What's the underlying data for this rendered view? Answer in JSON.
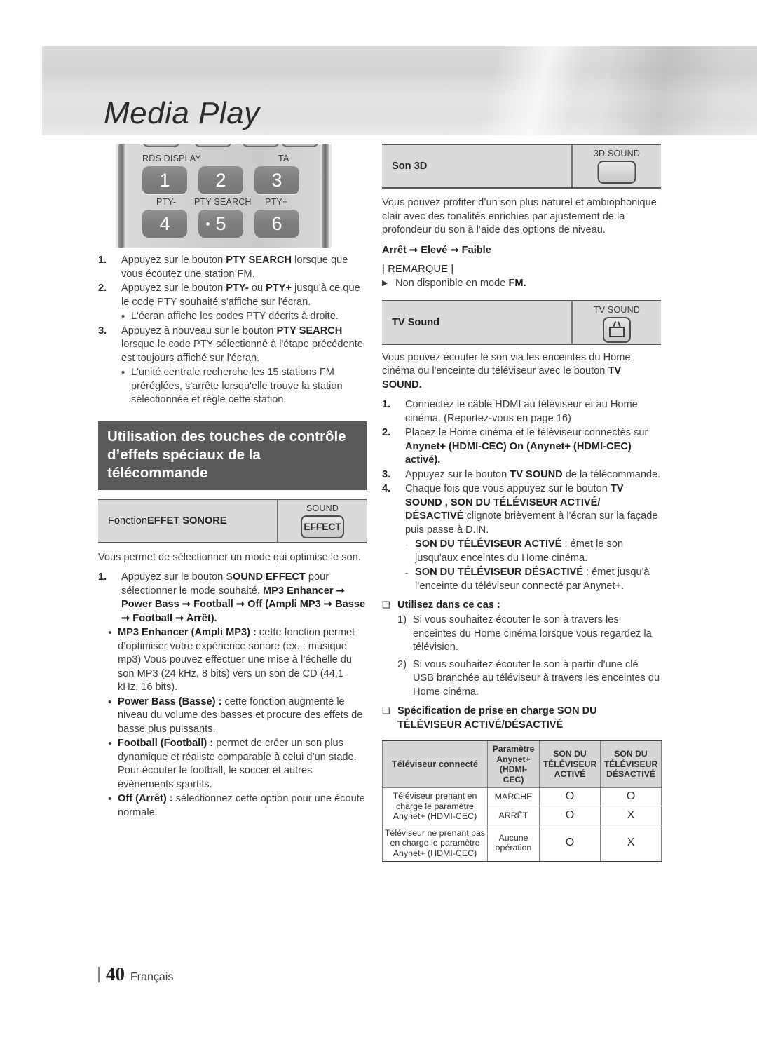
{
  "header": {
    "title": "Media Play"
  },
  "remote": {
    "labels": {
      "rds": "RDS DISPLAY",
      "ta": "TA",
      "ptyminus": "PTY-",
      "ptysearch": "PTY SEARCH",
      "ptyplus": "PTY+"
    },
    "keys": [
      "1",
      "2",
      "3",
      "4",
      "5",
      "6"
    ]
  },
  "left": {
    "steps": [
      {
        "num": "1.",
        "html": "Appuyez sur le bouton <b>PTY SEARCH</b> lorsque que vous écoutez une station FM."
      },
      {
        "num": "2.",
        "html": "Appuyez sur le bouton <b>PTY-</b> ou <b>PTY+</b> jusqu'à ce que le code PTY souhaité s'affiche sur l'écran."
      },
      {
        "num": "3.",
        "html": "Appuyez à nouveau sur le bouton <b>PTY SEARCH</b> lorsque le code PTY sélectionné à l'étape précédente est toujours affiché sur l'écran."
      }
    ],
    "bullet_after_2": "L'écran affiche les codes PTY décrits à droite.",
    "bullet_after_3": "L'unité centrale recherche les 15 stations FM préréglées, s'arrête lorsqu'elle trouve la station sélectionnée et règle cette station.",
    "section_title": "Utilisation des touches de contrôle d’effets spéciaux de la télécommande",
    "feature": {
      "label_plain": "Fonction ",
      "label_bold": "EFFET SONORE",
      "key_label": "SOUND",
      "key_text": "EFFECT"
    },
    "intro": "Vous permet de sélectionner un mode qui optimise le son.",
    "step1": {
      "num": "1.",
      "html": "Appuyez sur le bouton S<b>OUND EFFECT</b> pour sélectionner le mode souhaité. <b>MP3 Enhancer ➞ Power Bass ➞ Football ➞ Off (Ampli MP3 ➞ Basse ➞ Football ➞ Arrêt).</b>"
    },
    "mode_bullets": [
      "<b>MP3 Enhancer (Ampli MP3) :</b> cette fonction permet d’optimiser votre expérience sonore (ex. : musique mp3) Vous pouvez effectuer une mise à l’échelle du son MP3 (24 kHz, 8 bits) vers un son de CD (44,1 kHz, 16 bits).",
      "<b>Power Bass (Basse) :</b> cette fonction augmente le niveau du volume des basses et procure des effets de basse plus puissants.",
      "<b>Football (Football) :</b> permet de créer un son plus dynamique et réaliste comparable à celui d’un stade. Pour écouter le football, le soccer et autres événements sportifs.",
      "<b>Off (Arrêt) :</b> sélectionnez cette option pour une écoute normale."
    ]
  },
  "right": {
    "feature_3d": {
      "label": "Son 3D",
      "key_label": "3D SOUND"
    },
    "para_3d": "Vous pouvez profiter d’un son plus naturel et ambiophonique clair avec des tonalités enrichies par ajustement de la profondeur du son à l’aide des options de niveau.",
    "cycle_3d": "Arrêt ➞ Elevé ➞ Faible",
    "note_title": "| REMARQUE |",
    "note_item": "Non disponible en mode <b>FM.</b>",
    "feature_tv": {
      "label": "TV Sound",
      "key_label": "TV SOUND"
    },
    "para_tv": "Vous pouvez écouter le son via les enceintes du Home cinéma ou l'enceinte du téléviseur avec le bouton <b>TV SOUND.</b>",
    "steps": [
      {
        "num": "1.",
        "html": "Connectez le câble HDMI au téléviseur et au Home cinéma. (Reportez-vous en page 16)"
      },
      {
        "num": "2.",
        "html": "Placez le Home cinéma et le téléviseur connectés sur <b>Anynet+ (HDMI-CEC) On (Anynet+ (HDMI-CEC) activé).</b>"
      },
      {
        "num": "3.",
        "html": "Appuyez sur le bouton <b>TV SOUND</b> de la télécommande."
      },
      {
        "num": "4.",
        "html": "Chaque fois que vous appuyez sur le bouton <b>TV SOUND , SON DU TÉLÉVISEUR ACTIVÉ/ DÉSACTIVÉ</b> clignote brièvement à l'écran sur la façade puis passe à D.IN."
      }
    ],
    "dash_items": [
      "<span class=\"bcond\">SON DU TÉLÉVISEUR ACTIVÉ</span> : émet le son jusqu'aux enceintes du Home cinéma.",
      "<span class=\"bcond\">SON DU TÉLÉVISEUR DÉSACTIVÉ</span> : émet jusqu'à l’enceinte du téléviseur connecté par Anynet+."
    ],
    "use_case_title": "Utilisez dans ce cas :",
    "use_cases": [
      {
        "n": "1)",
        "t": "Si vous souhaitez écouter le son à travers les enceintes du Home cinéma lorsque vous regardez la télévision."
      },
      {
        "n": "2)",
        "t": "Si vous souhaitez écouter le son à partir d'une clé USB branchée au téléviseur à travers les enceintes du Home cinéma."
      }
    ],
    "spec_title": "Spécification de prise en charge SON DU TÉLÉVISEUR ACTIVÉ/DÉSACTIVÉ",
    "table": {
      "headers": [
        "Téléviseur connecté",
        "Paramètre Anynet+ (HDMI-CEC)",
        "SON DU TÉLÉVISEUR ACTIVÉ",
        "SON DU TÉLÉVISEUR DÉSACTIVÉ"
      ],
      "rows": [
        {
          "tv": "Téléviseur prenant en charge le paramètre Anynet+ (HDMI-CEC)",
          "param": "MARCHE",
          "on": "O",
          "off": "O"
        },
        {
          "param": "ARRÊT",
          "on": "O",
          "off": "X"
        },
        {
          "tv": "Téléviseur ne prenant pas en charge le paramètre Anynet+ (HDMI-CEC)",
          "param": "Aucune opération",
          "on": "O",
          "off": "X"
        }
      ]
    }
  },
  "footer": {
    "page": "40",
    "language": "Français"
  }
}
